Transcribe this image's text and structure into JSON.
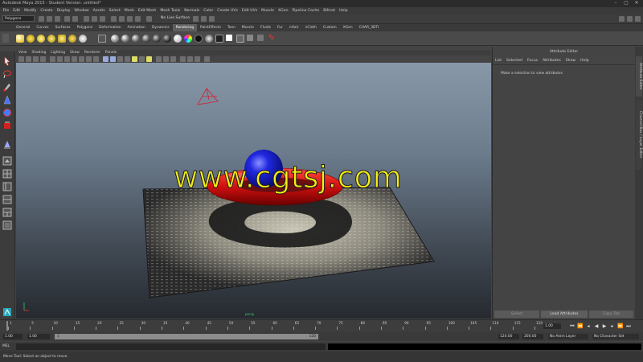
{
  "window": {
    "title": "Autodesk Maya 2015 - Student Version: untitled*",
    "buttons": [
      "–",
      "▢",
      "✕"
    ]
  },
  "menubar": [
    "File",
    "Edit",
    "Modify",
    "Create",
    "Display",
    "Window",
    "Assets",
    "Select",
    "Mesh",
    "Edit Mesh",
    "Mesh Tools",
    "Normals",
    "Color",
    "Create UVs",
    "Edit UVs",
    "Muscle",
    "XGen",
    "Pipeline Cache",
    "Bifrost",
    "Help"
  ],
  "statusline": {
    "mode": "Polygons",
    "live_surface": "No Live Surface"
  },
  "shelf_tabs": [
    "General",
    "Curves",
    "Surfaces",
    "Polygons",
    "Deformation",
    "Animation",
    "Dynamics",
    "Rendering",
    "PaintEffects",
    "Toon",
    "Muscle",
    "Fluids",
    "Fur",
    "nHair",
    "nCloth",
    "Custom",
    "XGen",
    "CHAR_3DTI"
  ],
  "active_shelf_tab": "Rendering",
  "viewport_menu": [
    "View",
    "Shading",
    "Lighting",
    "Show",
    "Renderer",
    "Panels"
  ],
  "viewport": {
    "camera_label": "persp",
    "watermark": "www.cgtsj.com"
  },
  "attribute_editor": {
    "title": "Attribute Editor",
    "menu": [
      "List",
      "Selected",
      "Focus",
      "Attributes",
      "Show",
      "Help"
    ],
    "message": "Make a selection to view attributes",
    "buttons": {
      "select": "Select",
      "load": "Load Attributes",
      "copy": "Copy Tab"
    }
  },
  "side_tabs": [
    "Attribute Editor",
    "Channel Box / Layer Editor"
  ],
  "timeline": {
    "ticks": [
      "1",
      "5",
      "10",
      "15",
      "20",
      "25",
      "30",
      "35",
      "40",
      "45",
      "50",
      "55",
      "60",
      "65",
      "70",
      "75",
      "80",
      "85",
      "90",
      "95",
      "100",
      "105",
      "110",
      "115",
      "120"
    ],
    "current": "1.00"
  },
  "range": {
    "start": "1.00",
    "playback_start": "1.00",
    "slider_start": "1",
    "slider_end": "120",
    "playback_end": "120.00",
    "end": "200.00",
    "anim_layer": "No Anim Layer",
    "character_set": "No Character Set"
  },
  "command": {
    "label": "MEL"
  },
  "help_line": "Move Tool: Select an object to move.",
  "colors": {
    "watermark": "#f6ef14",
    "torus": "#d81818",
    "sphere": "#1520d8",
    "accent": "#5e5e5e"
  }
}
